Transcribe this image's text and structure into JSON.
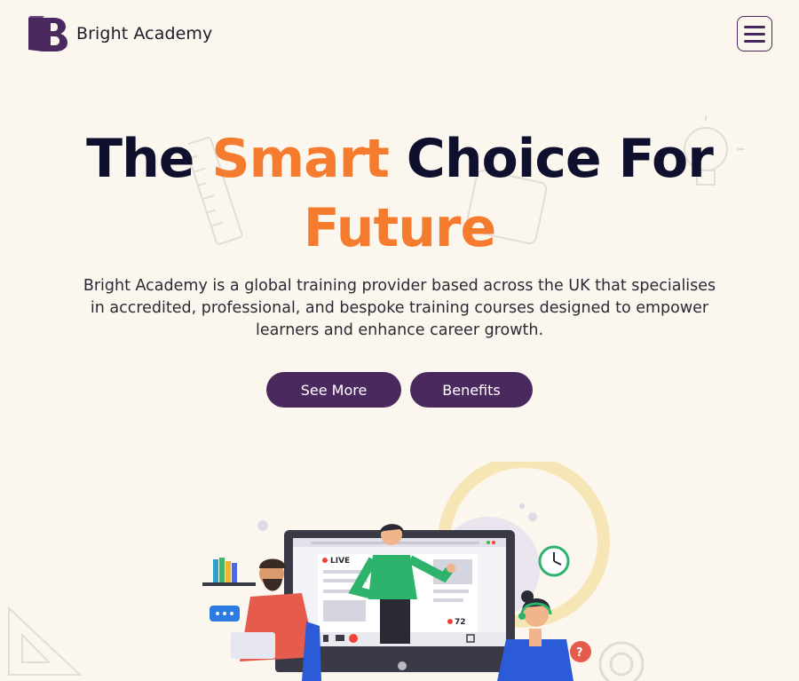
{
  "header": {
    "brand": "Bright Academy",
    "menu_icon": "hamburger-icon"
  },
  "hero": {
    "title_part1": "The ",
    "title_accent1": "Smart",
    "title_part2": " Choice For",
    "title_accent2": "Future",
    "description": "Bright Academy is a global training provider based across the UK that specialises in accredited, professional, and bespoke training courses designed to empower learners and enhance career growth.",
    "see_more_label": "See More",
    "benefits_label": "Benefits"
  },
  "illustration": {
    "live_label": "LIVE",
    "viewer_count": "72"
  },
  "colors": {
    "background": "#fcf7ee",
    "accent": "#f57c2e",
    "primary": "#4a2a5e",
    "heading": "#0f0f2e"
  }
}
